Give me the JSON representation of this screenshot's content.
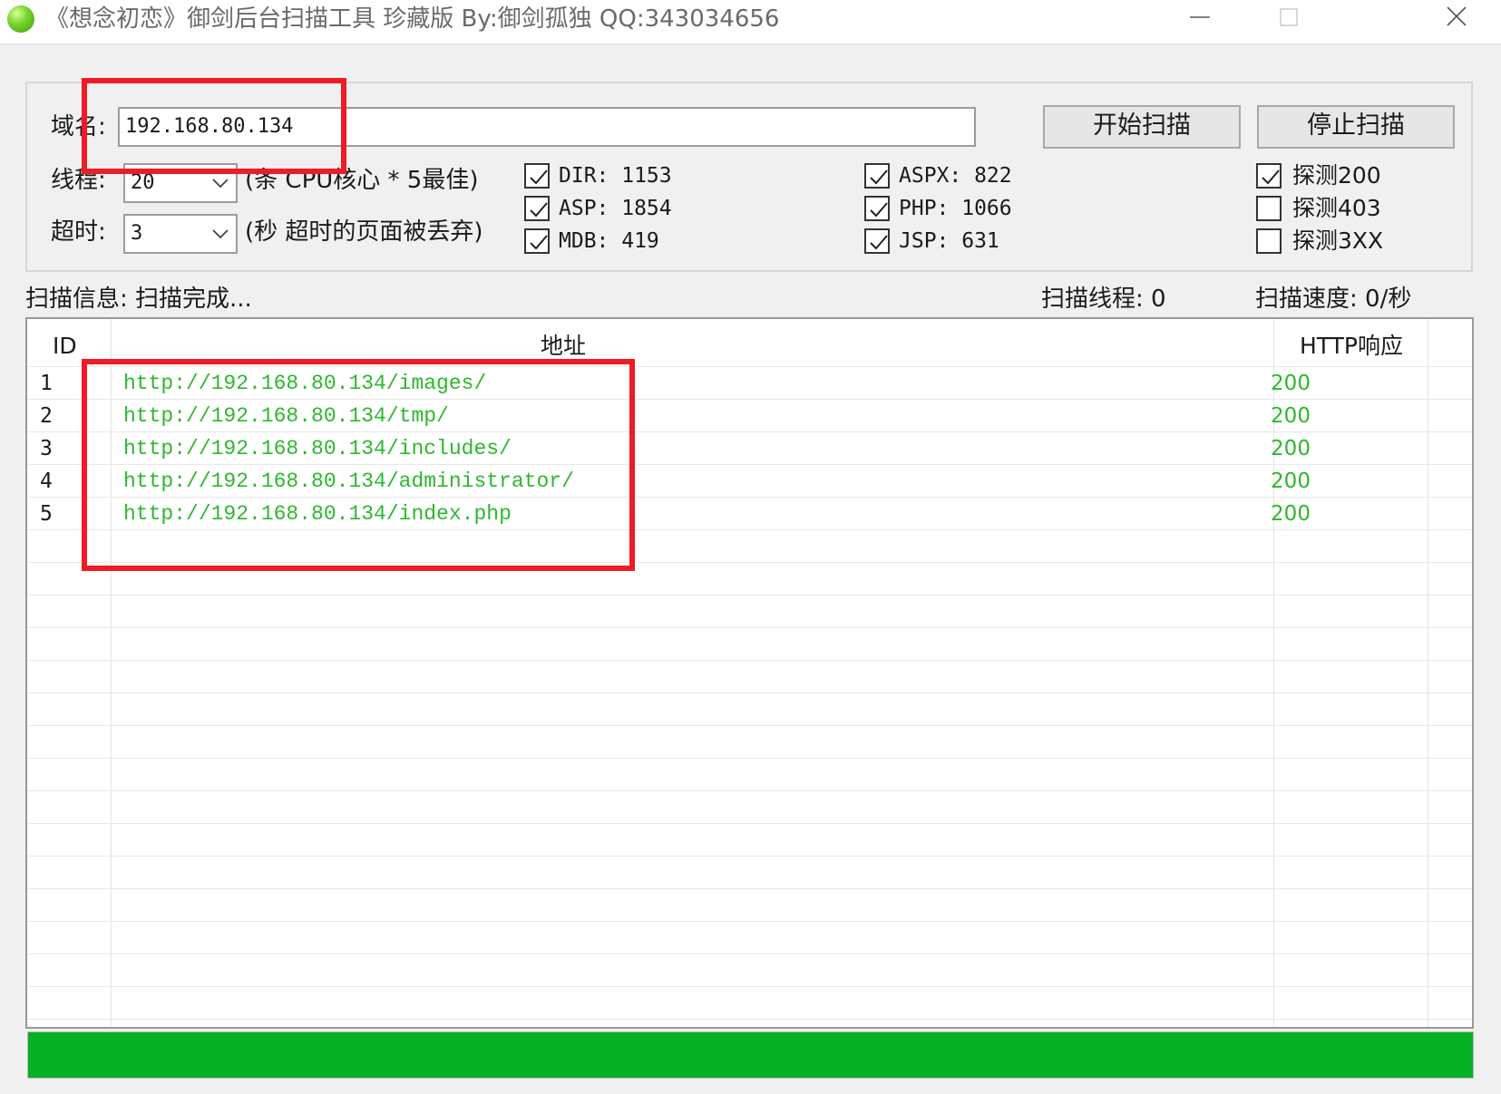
{
  "window": {
    "title": "《想念初恋》御剑后台扫描工具 珍藏版 By:御剑孤独 QQ:343034656"
  },
  "config": {
    "domain_label": "域名:",
    "domain_value": "192.168.80.134",
    "threads_label": "线程:",
    "threads_value": "20",
    "threads_hint": "(条 CPU核心 * 5最佳)",
    "timeout_label": "超时:",
    "timeout_value": "3",
    "timeout_hint": "(秒 超时的页面被丢弃)",
    "start_button": "开始扫描",
    "stop_button": "停止扫描"
  },
  "dictionaries": [
    {
      "label": "DIR: 1153",
      "checked": true
    },
    {
      "label": "ASP: 1854",
      "checked": true
    },
    {
      "label": "MDB: 419",
      "checked": true
    },
    {
      "label": "ASPX: 822",
      "checked": true
    },
    {
      "label": "PHP: 1066",
      "checked": true
    },
    {
      "label": "JSP: 631",
      "checked": true
    }
  ],
  "detect_options": [
    {
      "label": "探测200",
      "checked": true
    },
    {
      "label": "探测403",
      "checked": false
    },
    {
      "label": "探测3XX",
      "checked": false
    }
  ],
  "status": {
    "info": "扫描信息: 扫描完成...",
    "threads": "扫描线程: 0",
    "speed": "扫描速度: 0/秒"
  },
  "table": {
    "columns": [
      "ID",
      "地址",
      "HTTP响应"
    ],
    "rows": [
      {
        "id": "1",
        "url": "http://192.168.80.134/images/",
        "code": "200"
      },
      {
        "id": "2",
        "url": "http://192.168.80.134/tmp/",
        "code": "200"
      },
      {
        "id": "3",
        "url": "http://192.168.80.134/includes/",
        "code": "200"
      },
      {
        "id": "4",
        "url": "http://192.168.80.134/administrator/",
        "code": "200"
      },
      {
        "id": "5",
        "url": "http://192.168.80.134/index.php",
        "code": "200"
      }
    ]
  },
  "progress": {
    "percent": 100
  },
  "colors": {
    "result_text": "#2db82d",
    "progress": "#06b025",
    "highlight": "#ee1c25"
  },
  "icons": [
    "app-icon",
    "minimize-icon",
    "maximize-icon",
    "close-icon",
    "chevron-down-icon",
    "checkmark-icon"
  ]
}
